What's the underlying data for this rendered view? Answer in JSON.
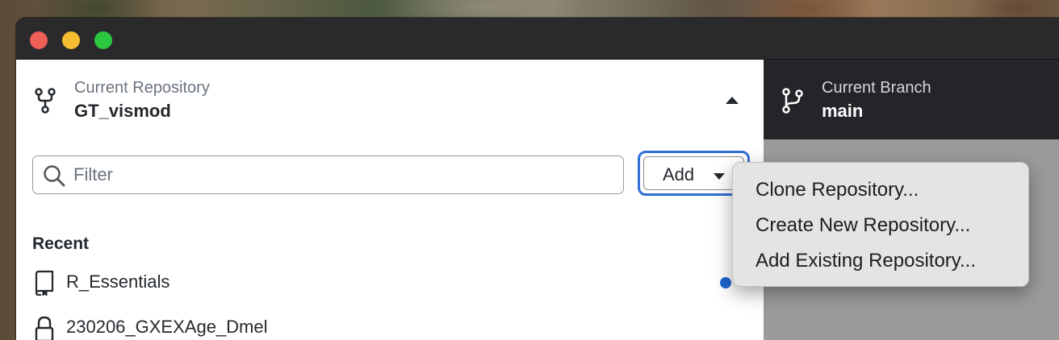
{
  "window": {
    "traffic_lights": {
      "close": "#ee5f57",
      "minimize": "#f5bd2f",
      "maximize": "#2cc840"
    }
  },
  "repository": {
    "label": "Current Repository",
    "name": "GT_vismod",
    "icon": "repo-fork-icon",
    "dropdown_state": "expanded"
  },
  "branch": {
    "label": "Current Branch",
    "name": "main",
    "icon": "git-branch-icon"
  },
  "filter": {
    "placeholder": "Filter",
    "value": ""
  },
  "add_button": {
    "label": "Add",
    "accent": "#2f6fd6"
  },
  "recent": {
    "heading": "Recent",
    "items": [
      {
        "label": "R_Essentials",
        "icon": "repo-icon",
        "has_changes": true
      },
      {
        "label": "230206_GXEXAge_Dmel",
        "icon": "lock-icon",
        "has_changes": false
      }
    ]
  },
  "add_menu": {
    "items": [
      {
        "label": "Clone Repository..."
      },
      {
        "label": "Create New Repository..."
      },
      {
        "label": "Add Existing Repository..."
      }
    ]
  },
  "colors": {
    "change_dot": "#1f63d0",
    "header_dark": "#242529"
  }
}
